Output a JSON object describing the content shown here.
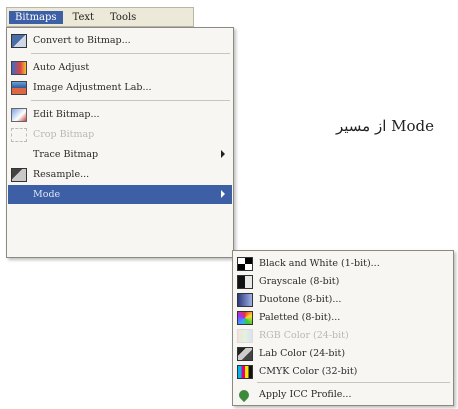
{
  "menubar": {
    "items": [
      {
        "label": "Bitmaps",
        "active": true
      },
      {
        "label": "Text",
        "active": false
      },
      {
        "label": "Tools",
        "active": false
      }
    ]
  },
  "bitmaps_menu": {
    "items": [
      {
        "label": "Convert to Bitmap...",
        "icon": "convert-bitmap-icon"
      },
      {
        "label": "Auto Adjust",
        "icon": "auto-adjust-icon"
      },
      {
        "label": "Image Adjustment Lab...",
        "icon": "image-adjustment-lab-icon"
      },
      {
        "label": "Edit Bitmap...",
        "icon": "edit-bitmap-icon"
      },
      {
        "label": "Crop Bitmap",
        "icon": "crop-bitmap-icon",
        "disabled": true
      },
      {
        "label": "Trace Bitmap",
        "submenu": true
      },
      {
        "label": "Resample...",
        "icon": "resample-icon"
      },
      {
        "label": "Mode",
        "submenu": true,
        "highlighted": true
      }
    ]
  },
  "mode_submenu": {
    "items": [
      {
        "label": "Black and White (1-bit)...",
        "icon": "black-white-icon"
      },
      {
        "label": "Grayscale (8-bit)",
        "icon": "grayscale-icon"
      },
      {
        "label": "Duotone (8-bit)...",
        "icon": "duotone-icon"
      },
      {
        "label": "Paletted (8-bit)...",
        "icon": "paletted-icon"
      },
      {
        "label": "RGB Color (24-bit)",
        "icon": "rgb-color-icon",
        "disabled": true
      },
      {
        "label": "Lab Color (24-bit)",
        "icon": "lab-color-icon"
      },
      {
        "label": "CMYK Color (32-bit)",
        "icon": "cmyk-color-icon"
      },
      {
        "label": "Apply ICC Profile...",
        "icon": "apply-icc-profile-icon"
      }
    ]
  },
  "side_text": "Mode از مسیر"
}
